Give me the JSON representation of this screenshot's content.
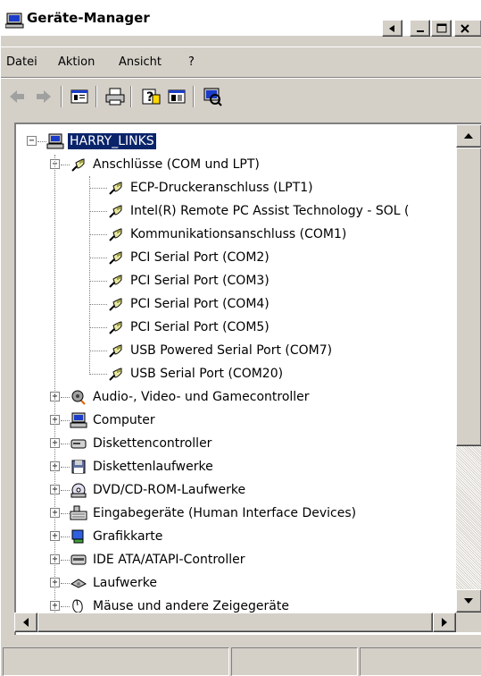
{
  "window": {
    "title": "Geräte-Manager",
    "icon": "computer-monitor-icon"
  },
  "caption_buttons": {
    "restore_icon": "restore-icon",
    "minimize_icon": "minimize-icon",
    "maximize_icon": "maximize-icon",
    "close_icon": "close-icon"
  },
  "menu": {
    "items": [
      "Datei",
      "Aktion",
      "Ansicht",
      "?"
    ]
  },
  "toolbar": {
    "buttons": [
      "back-arrow-icon",
      "forward-arrow-icon",
      "properties-view-icon",
      "print-icon",
      "help-icon",
      "console-view-icon",
      "scan-hardware-icon"
    ]
  },
  "tree": {
    "root": {
      "label": "HARRY_LINKS",
      "icon": "computer-icon",
      "expanded": true,
      "selected": true
    },
    "items": [
      {
        "label": "Anschlüsse (COM und LPT)",
        "icon": "port-connector-icon",
        "level": 1,
        "expanded": true
      },
      {
        "label": "ECP-Druckeranschluss (LPT1)",
        "icon": "port-connector-icon",
        "level": 2
      },
      {
        "label": "Intel(R) Remote PC Assist Technology - SOL (",
        "icon": "port-connector-icon",
        "level": 2
      },
      {
        "label": "Kommunikationsanschluss (COM1)",
        "icon": "port-connector-icon",
        "level": 2
      },
      {
        "label": "PCI Serial Port (COM2)",
        "icon": "port-connector-icon",
        "level": 2
      },
      {
        "label": "PCI Serial Port (COM3)",
        "icon": "port-connector-icon",
        "level": 2
      },
      {
        "label": "PCI Serial Port (COM4)",
        "icon": "port-connector-icon",
        "level": 2
      },
      {
        "label": "PCI Serial Port (COM5)",
        "icon": "port-connector-icon",
        "level": 2
      },
      {
        "label": "USB Powered Serial Port (COM7)",
        "icon": "port-connector-icon",
        "level": 2
      },
      {
        "label": "USB Serial Port (COM20)",
        "icon": "port-connector-icon",
        "level": 2
      },
      {
        "label": "Audio-, Video- und Gamecontroller",
        "icon": "audio-speaker-icon",
        "level": 1,
        "expanded": false
      },
      {
        "label": "Computer",
        "icon": "computer-icon",
        "level": 1,
        "expanded": false
      },
      {
        "label": "Diskettencontroller",
        "icon": "disk-controller-icon",
        "level": 1,
        "expanded": false
      },
      {
        "label": "Diskettenlaufwerke",
        "icon": "floppy-drive-icon",
        "level": 1,
        "expanded": false
      },
      {
        "label": "DVD/CD-ROM-Laufwerke",
        "icon": "cd-drive-icon",
        "level": 1,
        "expanded": false
      },
      {
        "label": "Eingabegeräte (Human Interface Devices)",
        "icon": "keyboard-input-icon",
        "level": 1,
        "expanded": false
      },
      {
        "label": "Grafikkarte",
        "icon": "display-adapter-icon",
        "level": 1,
        "expanded": false
      },
      {
        "label": "IDE ATA/ATAPI-Controller",
        "icon": "ide-controller-icon",
        "level": 1,
        "expanded": false
      },
      {
        "label": "Laufwerke",
        "icon": "hard-drive-icon",
        "level": 1,
        "expanded": false
      },
      {
        "label": "Mäuse und andere Zeigegeräte",
        "icon": "mouse-icon",
        "level": 1,
        "expanded": false
      }
    ]
  },
  "scrollbars": {
    "vertical": {
      "up_icon": "scroll-up-arrow-icon",
      "down_icon": "scroll-down-arrow-icon"
    },
    "horizontal": {
      "left_icon": "scroll-left-arrow-icon",
      "right_icon": "scroll-right-arrow-icon"
    }
  },
  "statusbar": {
    "panels": [
      "",
      "",
      ""
    ]
  }
}
